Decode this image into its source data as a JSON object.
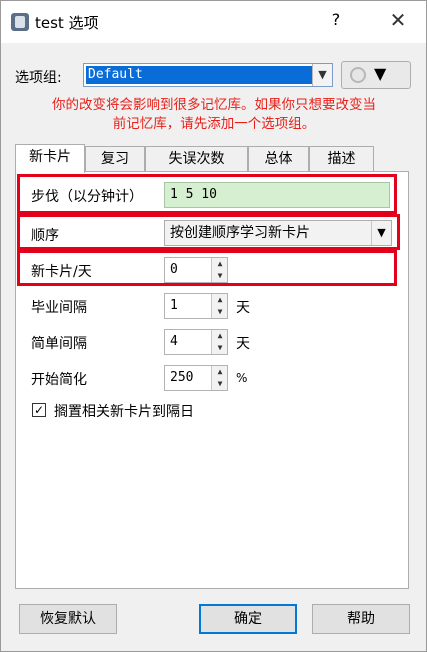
{
  "window": {
    "title": "test 选项",
    "help_glyph": "?",
    "close_glyph": "✕"
  },
  "options_group": {
    "label": "选项组:",
    "selected": "Default",
    "warning_line1": "你的改变将会影响到很多记忆库。如果你只想要改变当",
    "warning_line2": "前记忆库，请先添加一个选项组。"
  },
  "tabs": [
    "新卡片",
    "复习",
    "失误次数",
    "总体",
    "描述"
  ],
  "new_cards": {
    "steps_label": "步伐（以分钟计）",
    "steps_value": "1 5 10",
    "order_label": "顺序",
    "order_value": "按创建顺序学习新卡片",
    "per_day_label": "新卡片/天",
    "per_day_value": "0",
    "graduating_label": "毕业间隔",
    "graduating_value": "1",
    "graduating_unit": "天",
    "easy_label": "简单间隔",
    "easy_value": "4",
    "easy_unit": "天",
    "ease_label": "开始简化",
    "ease_value": "250",
    "ease_unit": "%",
    "bury_label": "搁置相关新卡片到隔日",
    "bury_checked": "✓"
  },
  "buttons": {
    "restore": "恢复默认",
    "ok": "确定",
    "help": "帮助"
  },
  "icons": {
    "dropdown": "▼",
    "spin_up": "▲",
    "spin_down": "▼",
    "gear_arrow": "▼"
  },
  "colors": {
    "warning": "#e8201a",
    "highlight_frame": "#e2001a",
    "selection": "#0a6cd6",
    "steps_field": "#d7efd1"
  }
}
